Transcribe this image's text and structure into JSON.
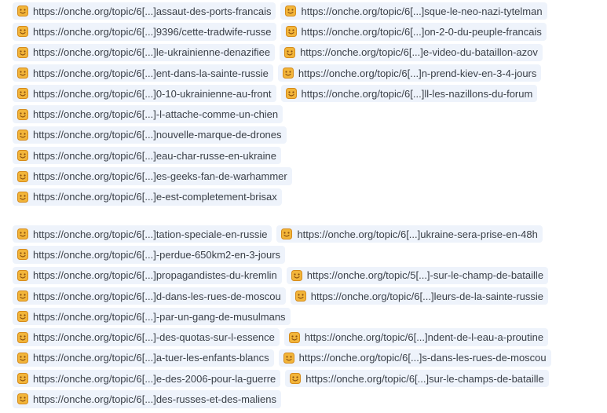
{
  "icon": {
    "name": "smiley-icon",
    "fill": "#f2b53a",
    "stroke": "#d58a1a",
    "mouth": "#8a4f10"
  },
  "colors": {
    "chip_bg": "#eef3fb",
    "text": "#3a3f47"
  },
  "groups": [
    {
      "lines": [
        [
          "https://onche.org/topic/6[...]assaut-des-ports-francais",
          "https://onche.org/topic/6[...]sque-le-neo-nazi-tytelman"
        ],
        [
          "https://onche.org/topic/6[...]9396/cette-tradwife-russe",
          "https://onche.org/topic/6[...]on-2-0-du-peuple-francais"
        ],
        [
          "https://onche.org/topic/6[...]le-ukrainienne-denazifiee",
          "https://onche.org/topic/6[...]e-video-du-bataillon-azov"
        ],
        [
          "https://onche.org/topic/6[...]ent-dans-la-sainte-russie",
          "https://onche.org/topic/6[...]n-prend-kiev-en-3-4-jours"
        ],
        [
          "https://onche.org/topic/6[...]0-10-ukrainienne-au-front",
          "https://onche.org/topic/6[...]ll-les-nazillons-du-forum"
        ],
        [
          "https://onche.org/topic/6[...]-l-attache-comme-un-chien"
        ],
        [
          "https://onche.org/topic/6[...]nouvelle-marque-de-drones"
        ],
        [
          "https://onche.org/topic/6[...]eau-char-russe-en-ukraine"
        ],
        [
          "https://onche.org/topic/6[...]es-geeks-fan-de-warhammer"
        ],
        [
          "https://onche.org/topic/6[...]e-est-completement-brisax"
        ]
      ]
    },
    {
      "lines": [
        [
          "https://onche.org/topic/6[...]tation-speciale-en-russie",
          "https://onche.org/topic/6[...]ukraine-sera-prise-en-48h"
        ],
        [
          "https://onche.org/topic/6[...]-perdue-650km2-en-3-jours"
        ],
        [
          "https://onche.org/topic/6[...]propagandistes-du-kremlin",
          "https://onche.org/topic/5[...]-sur-le-champ-de-bataille"
        ],
        [
          "https://onche.org/topic/6[...]d-dans-les-rues-de-moscou",
          "https://onche.org/topic/6[...]leurs-de-la-sainte-russie"
        ],
        [
          "https://onche.org/topic/6[...]-par-un-gang-de-musulmans"
        ],
        [
          "https://onche.org/topic/6[...]-des-quotas-sur-l-essence",
          "https://onche.org/topic/6[...]ndent-de-l-eau-a-proutine"
        ],
        [
          "https://onche.org/topic/6[...]a-tuer-les-enfants-blancs",
          "https://onche.org/topic/6[...]s-dans-les-rues-de-moscou"
        ],
        [
          "https://onche.org/topic/6[...]e-des-2006-pour-la-guerre",
          "https://onche.org/topic/6[...]sur-le-champs-de-bataille"
        ],
        [
          "https://onche.org/topic/6[...]des-russes-et-des-maliens"
        ]
      ]
    }
  ]
}
